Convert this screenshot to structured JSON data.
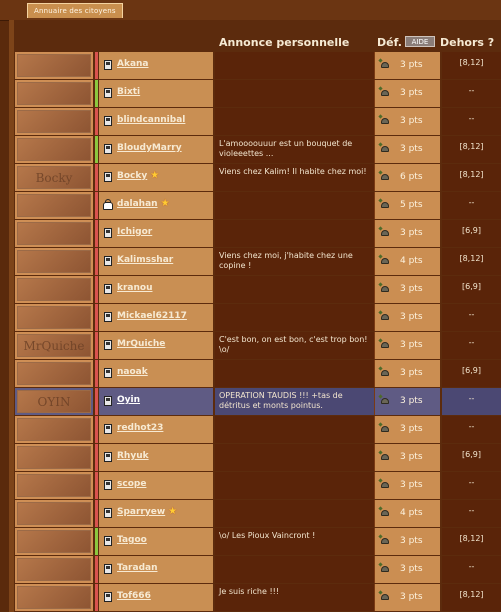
{
  "tab_label": "Annuaire des citoyens",
  "headers": {
    "message": "Annonce personnelle",
    "defense": "Déf.",
    "aide": "AIDE",
    "outside": "Dehors ?"
  },
  "colors": {
    "background": "#5a2a0c",
    "cell_light": "#c98f53",
    "cell_dark": "#5a2409",
    "highlight": "#5f5b84",
    "status_green": "#8cc73f",
    "status_red": "#d9534f",
    "star": "#ffcc33"
  },
  "citizens": [
    {
      "name": "Akana",
      "avatar": "",
      "status": "red",
      "icon": "phone-icon",
      "hero": false,
      "message": "",
      "defense": "3 pts",
      "outside": "[8,12]"
    },
    {
      "name": "Bixti",
      "avatar": "",
      "status": "green",
      "icon": "phone-icon",
      "hero": false,
      "message": "",
      "defense": "3 pts",
      "outside": "--"
    },
    {
      "name": "blindcannibal",
      "avatar": "",
      "status": "red",
      "icon": "phone-icon",
      "hero": false,
      "message": "",
      "defense": "3 pts",
      "outside": "--"
    },
    {
      "name": "BloudyMarry",
      "avatar": "",
      "status": "green",
      "icon": "phone-icon",
      "hero": false,
      "message": "L'amoooouuur est un bouquet de violeeettes ...",
      "defense": "3 pts",
      "outside": "[8,12]"
    },
    {
      "name": "Bocky",
      "avatar": "Bocky",
      "status": "red",
      "icon": "phone-icon",
      "hero": true,
      "message": "Viens chez Kalim! Il habite chez moi!",
      "defense": "6 pts",
      "outside": "[8,12]"
    },
    {
      "name": "dalahan",
      "avatar": "",
      "status": "red",
      "icon": "bag-icon",
      "hero": true,
      "message": "",
      "defense": "5 pts",
      "outside": "--"
    },
    {
      "name": "Ichigor",
      "avatar": "",
      "status": "red",
      "icon": "phone-icon",
      "hero": false,
      "message": "",
      "defense": "3 pts",
      "outside": "[6,9]"
    },
    {
      "name": "Kalimsshar",
      "avatar": "",
      "status": "red",
      "icon": "phone-icon",
      "hero": false,
      "message": "Viens chez moi, j'habite chez une copine !",
      "defense": "4 pts",
      "outside": "[8,12]"
    },
    {
      "name": "kranou",
      "avatar": "",
      "status": "red",
      "icon": "phone-icon",
      "hero": false,
      "message": "",
      "defense": "3 pts",
      "outside": "[6,9]"
    },
    {
      "name": "Mickael62117",
      "avatar": "",
      "status": "red",
      "icon": "phone-icon",
      "hero": false,
      "message": "",
      "defense": "3 pts",
      "outside": "--"
    },
    {
      "name": "MrQuiche",
      "avatar": "MrQuiche",
      "status": "red",
      "icon": "phone-icon",
      "hero": false,
      "message": "C'est bon, on est bon, c'est trop bon! \\o/",
      "defense": "3 pts",
      "outside": "--"
    },
    {
      "name": "naoak",
      "avatar": "",
      "status": "red",
      "icon": "phone-icon",
      "hero": false,
      "message": "",
      "defense": "3 pts",
      "outside": "[6,9]"
    },
    {
      "name": "Oyin",
      "avatar": "OYIN",
      "status": "red",
      "icon": "phone-icon",
      "hero": false,
      "message": "OPERATION TAUDIS !!! +tas de détritus et monts pointus.",
      "defense": "3 pts",
      "outside": "--",
      "highlight": true
    },
    {
      "name": "redhot23",
      "avatar": "",
      "status": "red",
      "icon": "phone-icon",
      "hero": false,
      "message": "",
      "defense": "3 pts",
      "outside": "--"
    },
    {
      "name": "Rhyuk",
      "avatar": "",
      "status": "red",
      "icon": "phone-icon",
      "hero": false,
      "message": "",
      "defense": "3 pts",
      "outside": "[6,9]"
    },
    {
      "name": "scope",
      "avatar": "",
      "status": "red",
      "icon": "phone-icon",
      "hero": false,
      "message": "",
      "defense": "3 pts",
      "outside": "--"
    },
    {
      "name": "Sparryew",
      "avatar": "",
      "status": "red",
      "icon": "phone-icon",
      "hero": true,
      "message": "",
      "defense": "4 pts",
      "outside": "--"
    },
    {
      "name": "Tagoo",
      "avatar": "",
      "status": "green",
      "icon": "phone-icon",
      "hero": false,
      "message": "\\o/ Les Pioux Vaincront !",
      "defense": "3 pts",
      "outside": "[8,12]"
    },
    {
      "name": "Taradan",
      "avatar": "",
      "status": "red",
      "icon": "phone-icon",
      "hero": false,
      "message": "",
      "defense": "3 pts",
      "outside": "--"
    },
    {
      "name": "Tof666",
      "avatar": "",
      "status": "red",
      "icon": "phone-icon",
      "hero": false,
      "message": "Je suis riche !!!",
      "defense": "3 pts",
      "outside": "[8,12]"
    }
  ]
}
